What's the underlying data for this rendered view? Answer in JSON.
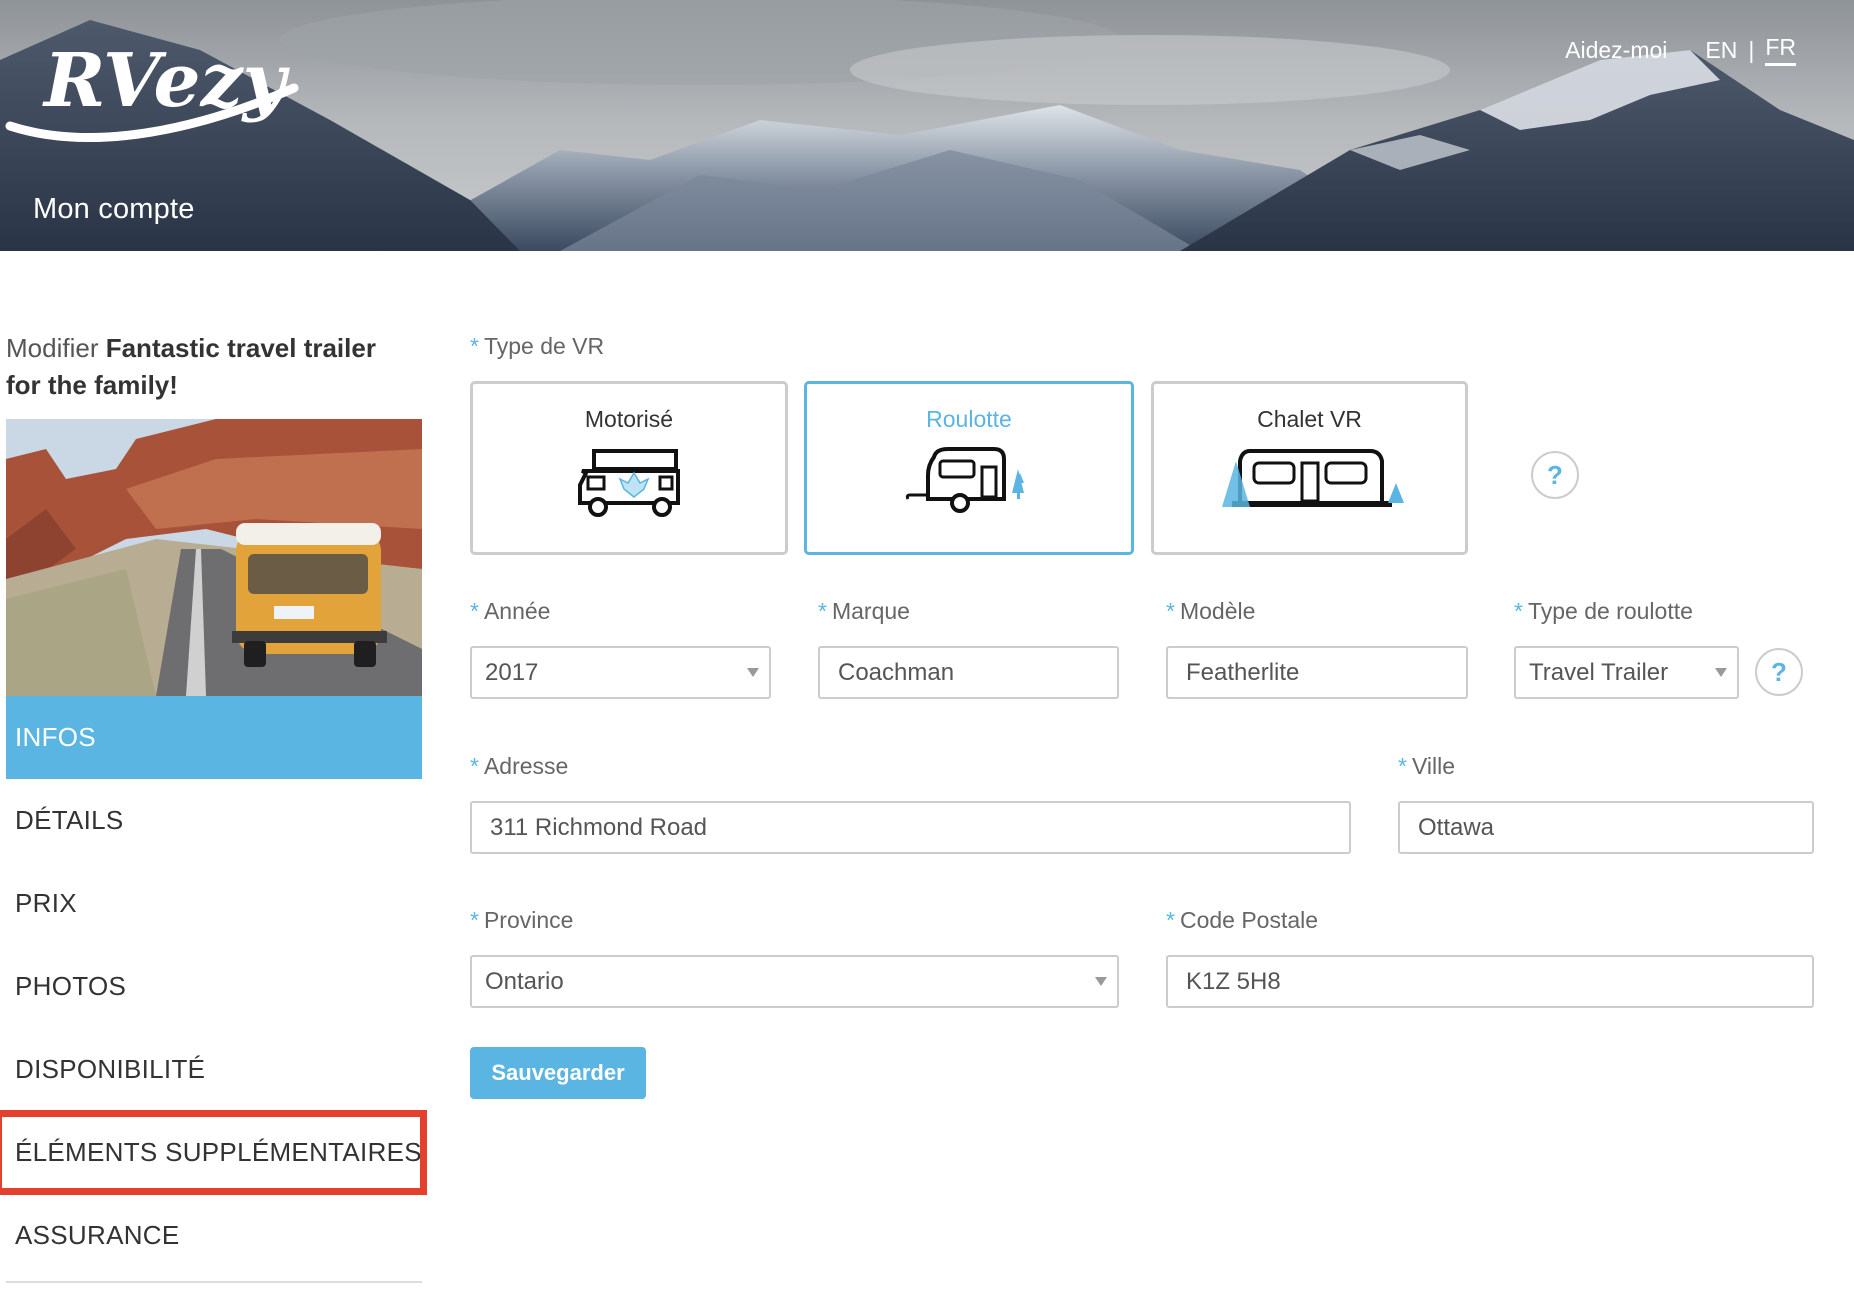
{
  "header": {
    "logo_text": "RVezy",
    "account_title": "Mon compte",
    "help_link": "Aidez-moi",
    "lang_en": "EN",
    "lang_separator": "|",
    "lang_fr": "FR"
  },
  "sidebar": {
    "edit_prefix": "Modifier",
    "listing_name": "Fantastic travel trailer for the family!",
    "menu": [
      {
        "label": "INFOS",
        "active": true
      },
      {
        "label": "DÉTAILS"
      },
      {
        "label": "PRIX"
      },
      {
        "label": "PHOTOS"
      },
      {
        "label": "DISPONIBILITÉ"
      },
      {
        "label": "ÉLÉMENTS SUPPLÉMENTAIRES",
        "highlighted": true
      },
      {
        "label": "ASSURANCE"
      }
    ]
  },
  "form": {
    "required_marker": "*",
    "rv_type_label": "Type de VR",
    "rv_types": [
      {
        "label": "Motorisé",
        "icon": "motorhome-icon"
      },
      {
        "label": "Roulotte",
        "icon": "travel-trailer-icon",
        "selected": true
      },
      {
        "label": "Chalet VR",
        "icon": "park-model-icon"
      }
    ],
    "help_symbol": "?",
    "year": {
      "label": "Année",
      "value": "2017"
    },
    "make": {
      "label": "Marque",
      "value": "Coachman"
    },
    "model": {
      "label": "Modèle",
      "value": "Featherlite"
    },
    "trailer_type": {
      "label": "Type de roulotte",
      "value": "Travel Trailer"
    },
    "address": {
      "label": "Adresse",
      "value": "311 Richmond Road"
    },
    "city": {
      "label": "Ville",
      "value": "Ottawa"
    },
    "province": {
      "label": "Province",
      "value": "Ontario"
    },
    "postal_code": {
      "label": "Code Postale",
      "value": "K1Z 5H8"
    },
    "save_label": "Sauvegarder"
  },
  "colors": {
    "accent": "#5ab5e2",
    "highlight_border": "#e4402e",
    "border": "#cccccc"
  }
}
